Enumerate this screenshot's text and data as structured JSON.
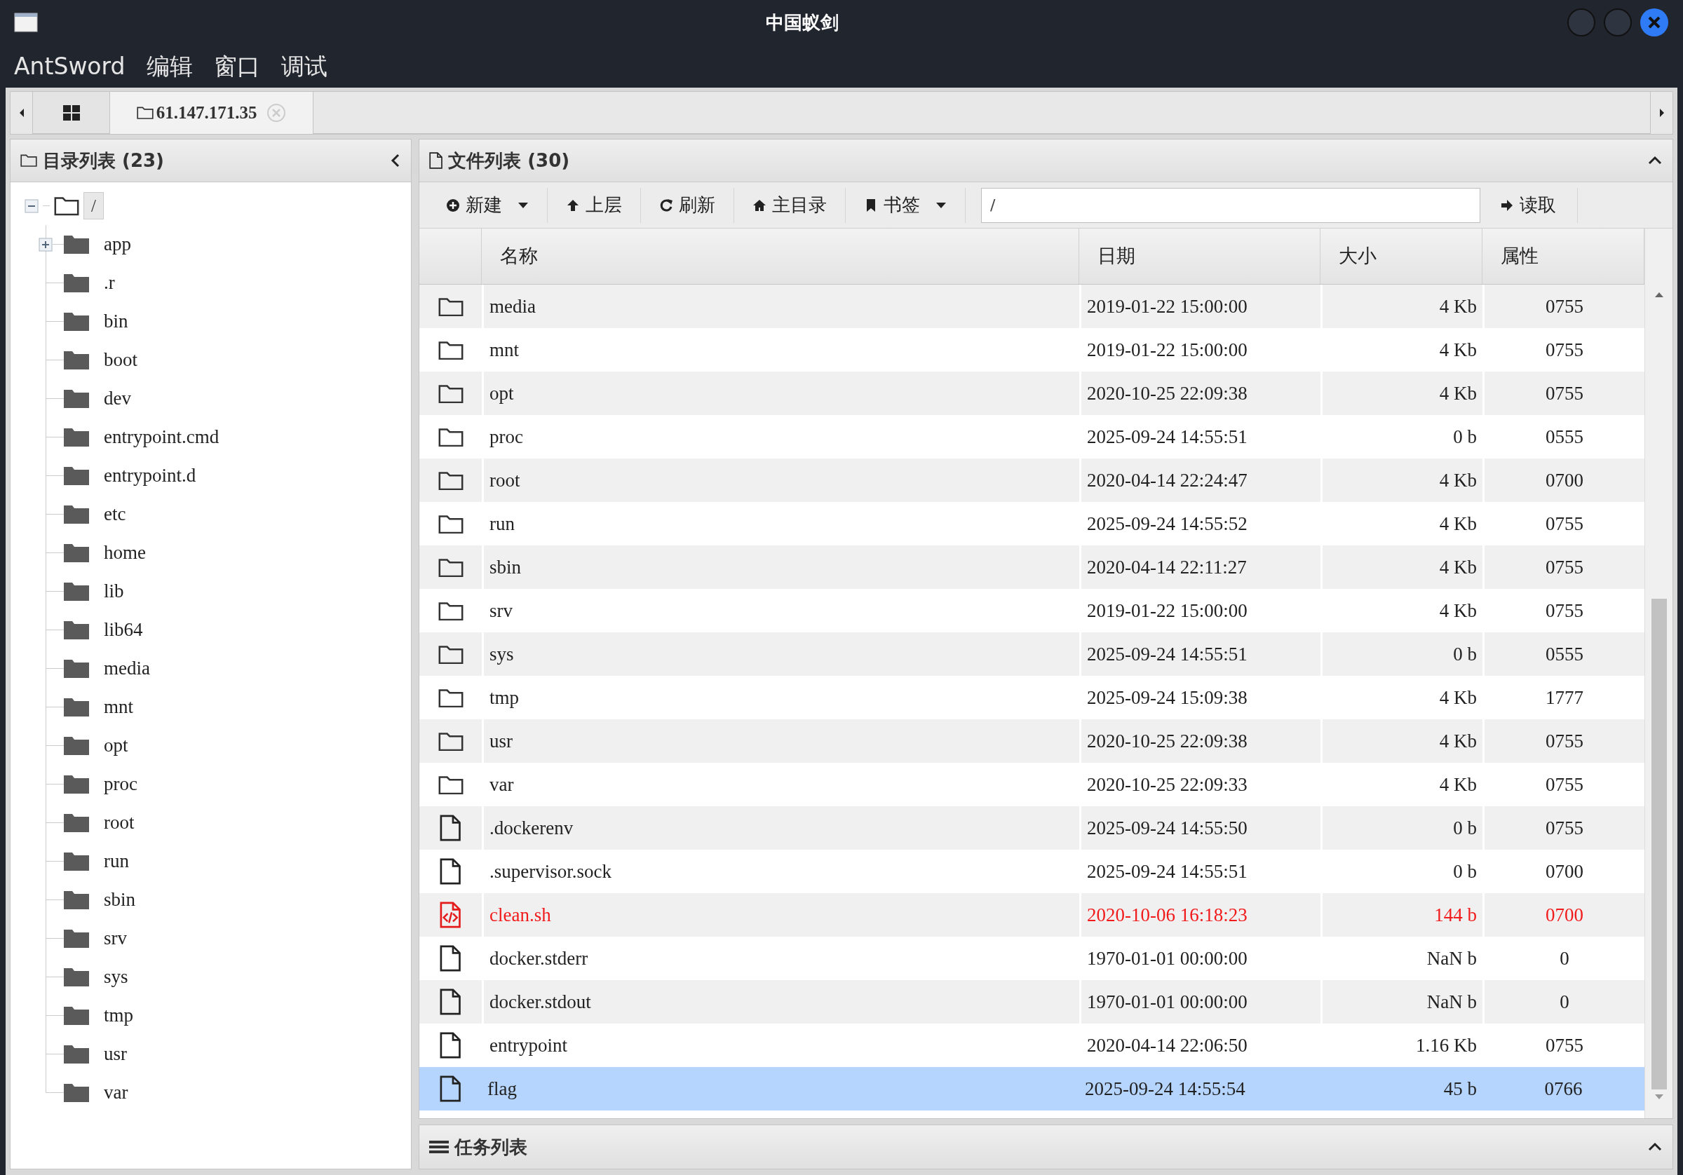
{
  "window": {
    "title": "中国蚁剑"
  },
  "menu": [
    "AntSword",
    "编辑",
    "窗口",
    "调试"
  ],
  "tabs": [
    {
      "kind": "home",
      "selected": false
    },
    {
      "kind": "shell",
      "label": "61.147.171.35",
      "selected": true
    }
  ],
  "directory_panel": {
    "title": "目录列表 (23)",
    "tree": {
      "label": "/",
      "expanded": true,
      "selected": true,
      "children": [
        {
          "label": "app",
          "expanded": false,
          "selected": false
        },
        {
          "label": ".r",
          "selected": false
        },
        {
          "label": "bin",
          "selected": false
        },
        {
          "label": "boot",
          "selected": false
        },
        {
          "label": "dev",
          "selected": false
        },
        {
          "label": "entrypoint.cmd",
          "selected": false
        },
        {
          "label": "entrypoint.d",
          "selected": false
        },
        {
          "label": "etc",
          "selected": false
        },
        {
          "label": "home",
          "selected": false
        },
        {
          "label": "lib",
          "selected": false
        },
        {
          "label": "lib64",
          "selected": false
        },
        {
          "label": "media",
          "selected": false
        },
        {
          "label": "mnt",
          "selected": false
        },
        {
          "label": "opt",
          "selected": false
        },
        {
          "label": "proc",
          "selected": false
        },
        {
          "label": "root",
          "selected": false
        },
        {
          "label": "run",
          "selected": false
        },
        {
          "label": "sbin",
          "selected": false
        },
        {
          "label": "srv",
          "selected": false
        },
        {
          "label": "sys",
          "selected": false
        },
        {
          "label": "tmp",
          "selected": false
        },
        {
          "label": "usr",
          "selected": false
        },
        {
          "label": "var",
          "selected": false
        }
      ]
    }
  },
  "file_panel": {
    "title": "文件列表 (30)",
    "toolbar": [
      {
        "kind": "new",
        "label": "新建",
        "dropdown": true
      },
      {
        "kind": "up",
        "label": "上层",
        "dropdown": false
      },
      {
        "kind": "refresh",
        "label": "刷新",
        "dropdown": false
      },
      {
        "kind": "home",
        "label": "主目录",
        "dropdown": false
      },
      {
        "kind": "bookmark",
        "label": "书签",
        "dropdown": true
      }
    ],
    "path": "/",
    "read_button": "读取",
    "columns": [
      "名称",
      "日期",
      "大小",
      "属性"
    ],
    "rows": [
      {
        "kind": "folder",
        "name": "media",
        "date": "2019-01-22 15:00:00",
        "size": "4 Kb",
        "mode": "0755",
        "selected": false
      },
      {
        "kind": "folder",
        "name": "mnt",
        "date": "2019-01-22 15:00:00",
        "size": "4 Kb",
        "mode": "0755",
        "selected": false
      },
      {
        "kind": "folder",
        "name": "opt",
        "date": "2020-10-25 22:09:38",
        "size": "4 Kb",
        "mode": "0755",
        "selected": false
      },
      {
        "kind": "folder",
        "name": "proc",
        "date": "2025-09-24 14:55:51",
        "size": "0 b",
        "mode": "0555",
        "selected": false
      },
      {
        "kind": "folder",
        "name": "root",
        "date": "2020-04-14 22:24:47",
        "size": "4 Kb",
        "mode": "0700",
        "selected": false
      },
      {
        "kind": "folder",
        "name": "run",
        "date": "2025-09-24 14:55:52",
        "size": "4 Kb",
        "mode": "0755",
        "selected": false
      },
      {
        "kind": "folder",
        "name": "sbin",
        "date": "2020-04-14 22:11:27",
        "size": "4 Kb",
        "mode": "0755",
        "selected": false
      },
      {
        "kind": "folder",
        "name": "srv",
        "date": "2019-01-22 15:00:00",
        "size": "4 Kb",
        "mode": "0755",
        "selected": false
      },
      {
        "kind": "folder",
        "name": "sys",
        "date": "2025-09-24 14:55:51",
        "size": "0 b",
        "mode": "0555",
        "selected": false
      },
      {
        "kind": "folder",
        "name": "tmp",
        "date": "2025-09-24 15:09:38",
        "size": "4 Kb",
        "mode": "1777",
        "selected": false
      },
      {
        "kind": "folder",
        "name": "usr",
        "date": "2020-10-25 22:09:38",
        "size": "4 Kb",
        "mode": "0755",
        "selected": false
      },
      {
        "kind": "folder",
        "name": "var",
        "date": "2020-10-25 22:09:33",
        "size": "4 Kb",
        "mode": "0755",
        "selected": false
      },
      {
        "kind": "file",
        "name": ".dockerenv",
        "date": "2025-09-24 14:55:50",
        "size": "0 b",
        "mode": "0755",
        "selected": false
      },
      {
        "kind": "file",
        "name": ".supervisor.sock",
        "date": "2025-09-24 14:55:51",
        "size": "0 b",
        "mode": "0700",
        "selected": false
      },
      {
        "kind": "script",
        "name": "clean.sh",
        "date": "2020-10-06 16:18:23",
        "size": "144 b",
        "mode": "0700",
        "selected": false
      },
      {
        "kind": "file",
        "name": "docker.stderr",
        "date": "1970-01-01 00:00:00",
        "size": "NaN b",
        "mode": "0",
        "selected": false
      },
      {
        "kind": "file",
        "name": "docker.stdout",
        "date": "1970-01-01 00:00:00",
        "size": "NaN b",
        "mode": "0",
        "selected": false
      },
      {
        "kind": "file",
        "name": "entrypoint",
        "date": "2020-04-14 22:06:50",
        "size": "1.16 Kb",
        "mode": "0755",
        "selected": false
      },
      {
        "kind": "file",
        "name": "flag",
        "date": "2025-09-24 14:55:54",
        "size": "45 b",
        "mode": "0766",
        "selected": true
      }
    ]
  },
  "task_panel": {
    "title": "任务列表"
  }
}
